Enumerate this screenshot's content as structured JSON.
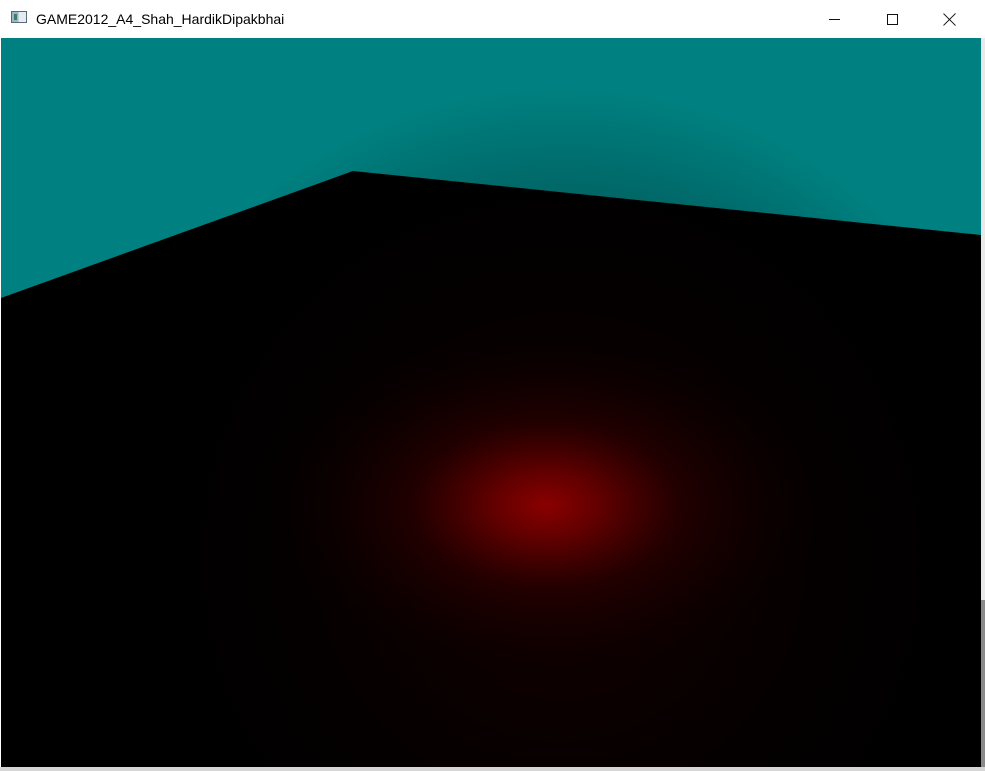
{
  "window": {
    "title": "GAME2012_A4_Shah_HardikDipakbhai",
    "icon": "application-window-icon",
    "controls": {
      "minimize": "minimize-icon",
      "maximize": "maximize-icon",
      "close": "close-icon"
    }
  },
  "scene": {
    "sky_color": "#008080",
    "floor_color": "#000000",
    "spotlight_color": "#8B0000"
  }
}
